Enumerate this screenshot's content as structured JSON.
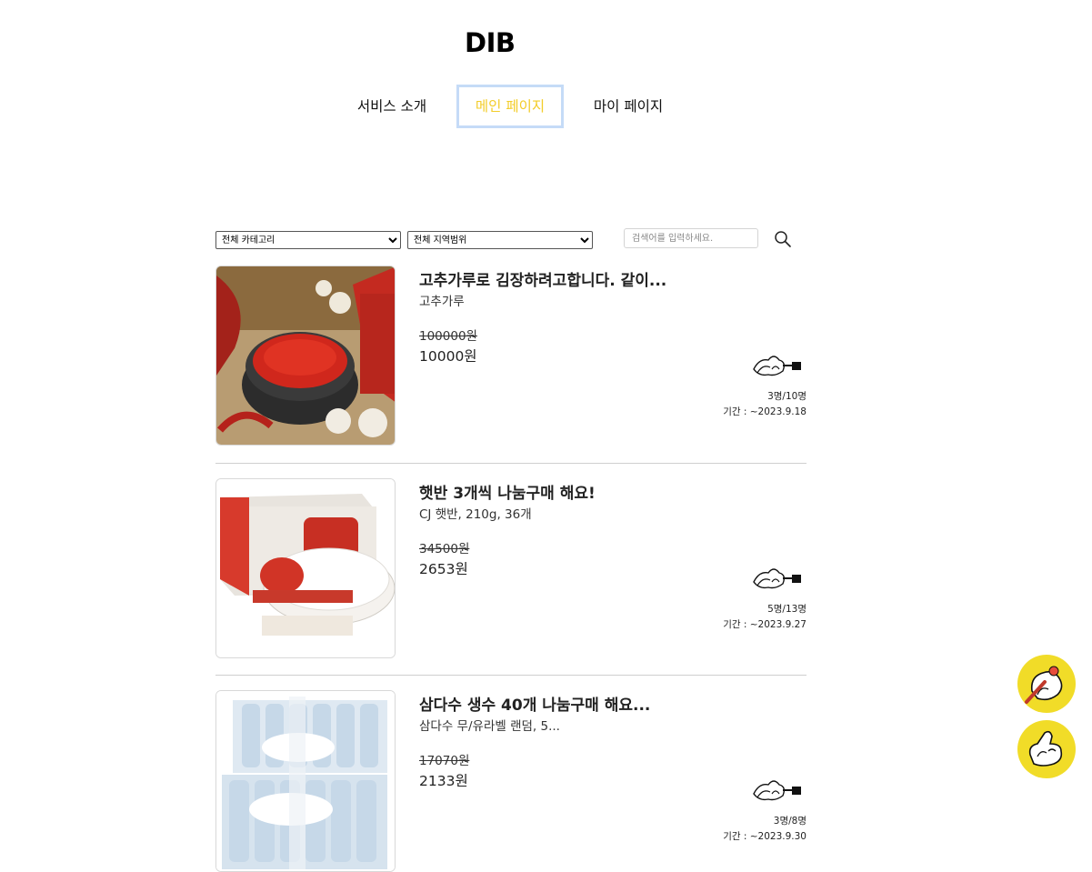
{
  "header": {
    "logo": "DIB"
  },
  "nav": {
    "items": [
      {
        "label": "서비스 소개"
      },
      {
        "label": "메인 페이지"
      },
      {
        "label": "마이 페이지"
      }
    ]
  },
  "filters": {
    "category": {
      "selected": "전체 카테고리"
    },
    "region": {
      "selected": "전체 지역범위"
    },
    "search": {
      "placeholder": "검색어를 입력하세요.",
      "value": ""
    }
  },
  "posts": [
    {
      "title": "고추가루로 김장하려고합니다. 같이...",
      "subtitle": "고추가루",
      "original_price": "100000원",
      "price": "10000원",
      "participants": "3명/10명",
      "period": "기간 : ~2023.9.18",
      "image_icon": "chili-powder-photo"
    },
    {
      "title": "햇반 3개씩 나눔구매 해요!",
      "subtitle": "CJ 햇반, 210g, 36개",
      "original_price": "34500원",
      "price": "2653원",
      "participants": "5명/13명",
      "period": "기간 : ~2023.9.27",
      "image_icon": "rice-box-photo"
    },
    {
      "title": "삼다수 생수 40개 나눔구매 해요...",
      "subtitle": "삼다수 무/유라벨 랜덤, 5...",
      "original_price": "17070원",
      "price": "2133원",
      "participants": "3명/8명",
      "period": "기간 : ~2023.9.30",
      "image_icon": "water-bottles-photo"
    }
  ],
  "colors": {
    "accent": "#f3cd2a",
    "fab": "#f1dc28",
    "nav_border": "#c5dbf7"
  }
}
